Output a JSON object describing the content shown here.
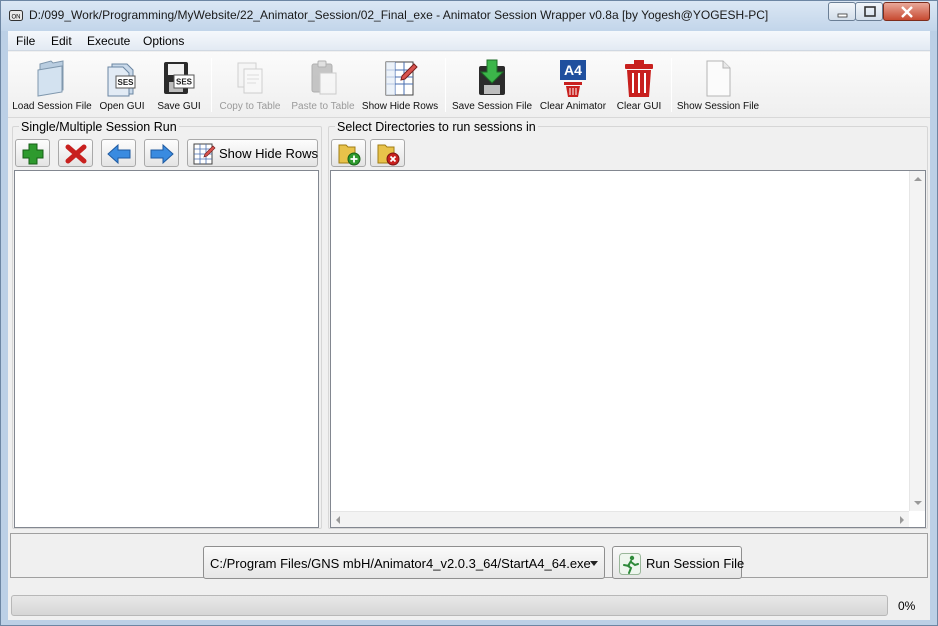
{
  "window": {
    "title": "D:/099_Work/Programming/MyWebsite/22_Animator_Session/02_Final_exe - Animator Session Wrapper v0.8a [by Yogesh@YOGESH-PC]"
  },
  "menu": {
    "items": [
      "File",
      "Edit",
      "Execute",
      "Options"
    ]
  },
  "toolbar": {
    "load_session_file": "Load Session File",
    "open_gui": "Open GUI",
    "save_gui": "Save GUI",
    "copy_to_table": "Copy to Table",
    "paste_to_table": "Paste to Table",
    "show_hide_rows": "Show Hide Rows",
    "save_session_file": "Save Session File",
    "clear_animator": "Clear Animator",
    "clear_gui": "Clear GUI",
    "show_session_file": "Show Session File",
    "disabled": [
      "copy_to_table",
      "paste_to_table"
    ]
  },
  "left_panel": {
    "title": "Single/Multiple Session Run",
    "show_hide_rows_label": "Show Hide Rows",
    "items": []
  },
  "right_panel": {
    "title": "Select Directories to run sessions in",
    "items": []
  },
  "bottom": {
    "executable_path": "C:/Program Files/GNS mbH/Animator4_v2.0.3_64/StartA4_64.exe",
    "run_label": "Run Session File"
  },
  "progress": {
    "value": 0,
    "text": "0%"
  },
  "colors": {
    "accent": "#3a6fc4",
    "add": "#2e9a2e",
    "remove": "#c8201e",
    "progress": "#37b44a"
  },
  "icons": {
    "load_session_file": "folder-icon",
    "open_gui": "ses-file-icon",
    "save_gui": "save-ses-icon",
    "copy_to_table": "copy-icon",
    "paste_to_table": "paste-icon",
    "show_hide_rows": "table-pencil-icon",
    "save_session_file": "save-arrow-icon",
    "clear_animator": "a4-trash-icon",
    "clear_gui": "trash-icon",
    "show_session_file": "document-icon"
  }
}
